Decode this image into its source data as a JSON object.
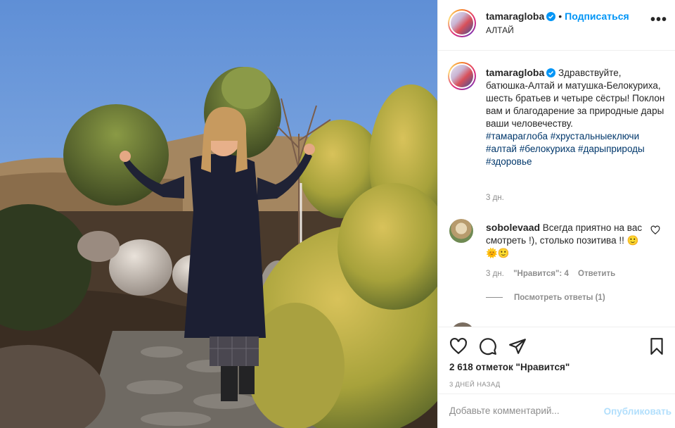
{
  "post": {
    "username": "tamaragloba",
    "follow_label": "Подписаться",
    "location": "АЛТАЙ",
    "more_label": "•••"
  },
  "caption": {
    "username": "tamaragloba",
    "text": "Здравствуйте, батюшка-Алтай и матушка-Белокуриха, шесть братьев и четыре сёстры! Поклон вам и благодарение за природные дары ваши человечеству.",
    "hashtags": "#тамараглоба #хрустальныеключи #алтай #белокуриха #дарыприроды #здоровье",
    "time": "3 дн."
  },
  "comment": {
    "username": "sobolevaad",
    "text": "Всегда приятно на вас смотреть !), столько позитива !! 🙂🌞🙂",
    "time": "3 дн.",
    "likes": "\"Нравится\": 4",
    "reply_label": "Ответить",
    "view_replies": "Посмотреть ответы (1)"
  },
  "stats": {
    "likes": "2 618 отметок \"Нравится\"",
    "date": "3 ДНЕЙ НАЗАД"
  },
  "add_comment": {
    "placeholder": "Добавьте комментарий...",
    "publish_label": "Опубликовать"
  },
  "icons": {
    "like": "heart-icon",
    "comment": "comment-icon",
    "share": "paper-plane-icon",
    "save": "bookmark-icon",
    "verified": "verified-badge-icon"
  },
  "colors": {
    "accent": "#0095f6",
    "hashtag": "#00376b",
    "muted": "#8e8e8e",
    "publish_disabled": "#b2dffc"
  }
}
